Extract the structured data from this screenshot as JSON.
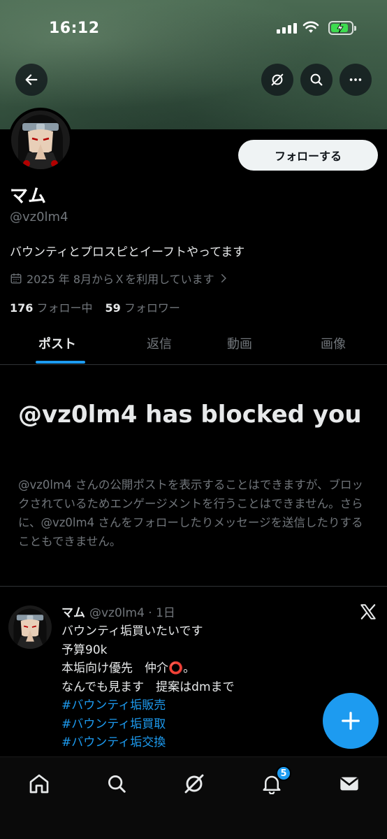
{
  "status_bar": {
    "time": "16:12"
  },
  "profile": {
    "display_name": "マム",
    "handle": "@vz0lm4",
    "bio": "バウンティとプロスピとイーフトやってます",
    "joined": "2025 年 8月からＸを利用しています",
    "following_count": "176",
    "following_label": "フォロー中",
    "followers_count": "59",
    "followers_label": "フォロワー",
    "follow_button": "フォローする"
  },
  "tabs": [
    {
      "label": "ポスト",
      "active": true
    },
    {
      "label": "返信",
      "active": false
    },
    {
      "label": "動画",
      "active": false
    },
    {
      "label": "画像",
      "active": false
    }
  ],
  "blocked_notice": {
    "title": "@vz0lm4 has blocked you",
    "description": "@vz0lm4 さんの公開ポストを表示することはできますが、ブロックされているためエンゲージメントを行うことはできません。さらに、@vz0lm4 さんをフォローしたりメッセージを送信したりすることもできません。"
  },
  "post": {
    "author": "マム",
    "meta": "@vz0lm4 · 1日",
    "lines": [
      "バウンティ垢買いたいです",
      "予算90k",
      "本垢向け優先　仲介⭕️。",
      "なんでも見ます　提案はdmまで"
    ],
    "hashtags": [
      "#バウンティ垢販売",
      "#バウンティ垢買取",
      "#バウンティ垢交換"
    ]
  },
  "notifications_badge": "5",
  "colors": {
    "accent": "#1d9bf0",
    "muted": "#71767b",
    "text": "#e7e9ea"
  }
}
